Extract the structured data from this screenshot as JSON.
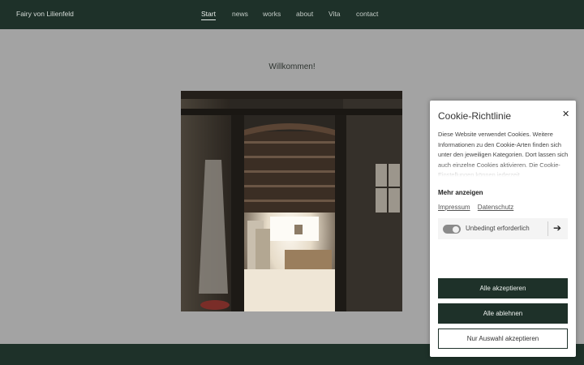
{
  "header": {
    "brand": "Fairy von Lilienfeld",
    "nav": [
      {
        "label": "Start",
        "active": true
      },
      {
        "label": "news"
      },
      {
        "label": "works"
      },
      {
        "label": "about"
      },
      {
        "label": "Vita"
      },
      {
        "label": "contact"
      }
    ]
  },
  "main": {
    "welcome": "Willkommen!"
  },
  "cookie": {
    "title": "Cookie-Richtlinie",
    "close_icon": "close-icon",
    "text": "Diese Website verwendet Cookies. Weitere Informationen zu den Cookie-Arten finden sich unter den jeweiligen Kategorien. Dort lassen sich auch einzelne Cookies aktivieren. Die Cookie-Einstellungen können jederzeit",
    "more": "Mehr anzeigen",
    "links": [
      "Impressum",
      "Datenschutz"
    ],
    "category": {
      "label": "Unbedingt erforderlich",
      "enabled": true
    },
    "buttons": {
      "accept_all": "Alle akzeptieren",
      "reject_all": "Alle ablehnen",
      "accept_selection": "Nur Auswahl akzeptieren"
    }
  },
  "colors": {
    "primary": "#1e3129",
    "background": "#a3a3a3"
  }
}
